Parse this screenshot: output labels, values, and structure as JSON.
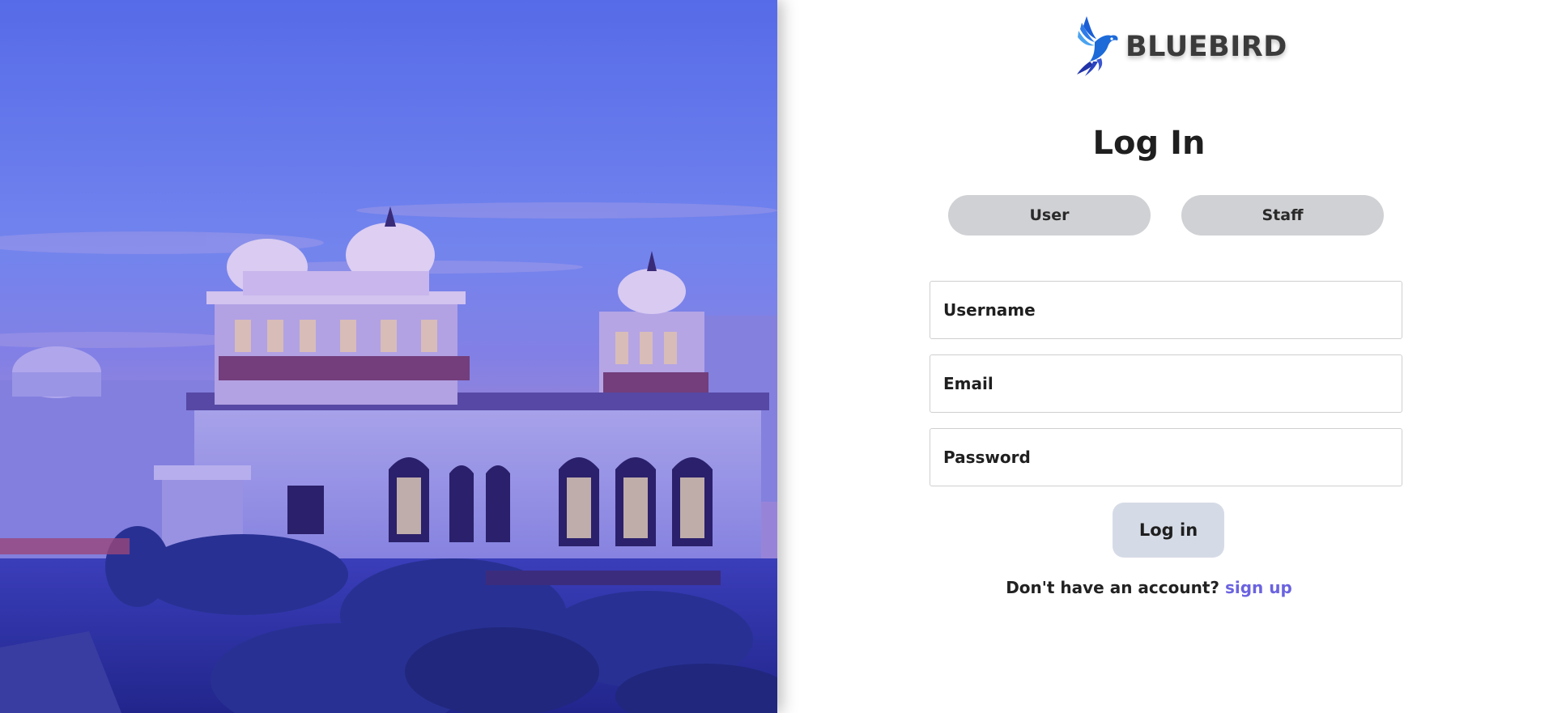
{
  "brand": {
    "name": "BLUEBIRD",
    "logo_icon": "bluebird-icon",
    "logo_colors": [
      "#1a5fd6",
      "#4aa3f0",
      "#2233a8"
    ]
  },
  "hero": {
    "image_icon": "palace-photo",
    "tint_color": "#4a4de0"
  },
  "login": {
    "title": "Log In",
    "roles": [
      "User",
      "Staff"
    ],
    "username_placeholder": "Username",
    "email_placeholder": "Email",
    "password_placeholder": "Password",
    "submit_label": "Log in",
    "signup_prompt": "Don't have an account?",
    "signup_link": "sign up",
    "link_color": "#6b63e0"
  }
}
